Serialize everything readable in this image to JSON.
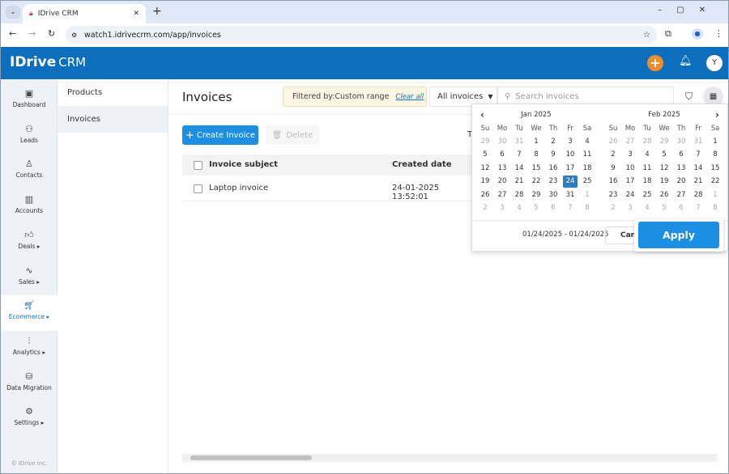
{
  "browser": {
    "tab_title": "IDrive CRM",
    "url": "watch1.idrivecrm.com/app/invoices"
  },
  "header": {
    "logo": "IDrive",
    "logo_suffix": "CRM",
    "avatar": "Y",
    "accent": "#f28c28",
    "bar_color": "#0b6fbd"
  },
  "sidebar": {
    "items": [
      {
        "label": "Dashboard",
        "icon": "dashboard-icon",
        "glyph": "▣"
      },
      {
        "label": "Leads",
        "icon": "leads-icon",
        "glyph": "⚇"
      },
      {
        "label": "Contacts",
        "icon": "contacts-icon",
        "glyph": "♙"
      },
      {
        "label": "Accounts",
        "icon": "accounts-icon",
        "glyph": "▥"
      },
      {
        "label": "Deals ▸",
        "icon": "deals-icon",
        "glyph": "👍︎"
      },
      {
        "label": "Sales ▸",
        "icon": "sales-icon",
        "glyph": "∿"
      },
      {
        "label": "Ecommerce ▸",
        "icon": "ecommerce-icon",
        "glyph": "🛒︎",
        "active": true
      },
      {
        "label": "Analytics ▸",
        "icon": "analytics-icon",
        "glyph": "⫶"
      },
      {
        "label": "Data Migration",
        "icon": "data-migration-icon",
        "glyph": "⛁"
      },
      {
        "label": "Settings ▸",
        "icon": "settings-icon",
        "glyph": "⚙"
      }
    ],
    "footer": "© IDrive Inc."
  },
  "submenu": {
    "items": [
      {
        "label": "Products"
      },
      {
        "label": "Invoices",
        "active": true
      }
    ]
  },
  "main": {
    "title": "Invoices",
    "filter_text": "Filtered by:Custom range",
    "clear_all": "Clear all",
    "view_select": "All invoices",
    "search_placeholder": "Search invoices",
    "create_label": "Create Invoice",
    "delete_label": "Delete",
    "truncated": "T",
    "columns": [
      "Invoice subject",
      "Created date"
    ],
    "rows": [
      {
        "subject": "Laptop invoice",
        "created": "24-01-2025 13:52:01"
      }
    ]
  },
  "calendar": {
    "weekdays": [
      "Su",
      "Mo",
      "Tu",
      "We",
      "Th",
      "Fr",
      "Sa"
    ],
    "months": [
      {
        "title": "Jan 2025",
        "weeks": [
          [
            "29",
            "30",
            "31",
            "1",
            "2",
            "3",
            "4"
          ],
          [
            "5",
            "6",
            "7",
            "8",
            "9",
            "10",
            "11"
          ],
          [
            "12",
            "13",
            "14",
            "15",
            "16",
            "17",
            "18"
          ],
          [
            "19",
            "20",
            "21",
            "22",
            "23",
            "24",
            "25"
          ],
          [
            "26",
            "27",
            "28",
            "29",
            "30",
            "31",
            "1"
          ],
          [
            "2",
            "3",
            "4",
            "5",
            "6",
            "7",
            "8"
          ]
        ]
      },
      {
        "title": "Feb 2025",
        "weeks": [
          [
            "26",
            "27",
            "28",
            "29",
            "30",
            "31",
            "1"
          ],
          [
            "2",
            "3",
            "4",
            "5",
            "6",
            "7",
            "8"
          ],
          [
            "9",
            "10",
            "11",
            "12",
            "13",
            "14",
            "15"
          ],
          [
            "16",
            "17",
            "18",
            "19",
            "20",
            "21",
            "22"
          ],
          [
            "23",
            "24",
            "25",
            "26",
            "27",
            "28",
            "1"
          ],
          [
            "2",
            "3",
            "4",
            "5",
            "6",
            "7",
            "8"
          ]
        ]
      }
    ],
    "selected": {
      "month": 0,
      "day": "24"
    },
    "range": "01/24/2025 - 01/24/2025",
    "cancel": "Cancel",
    "apply": "Apply"
  }
}
